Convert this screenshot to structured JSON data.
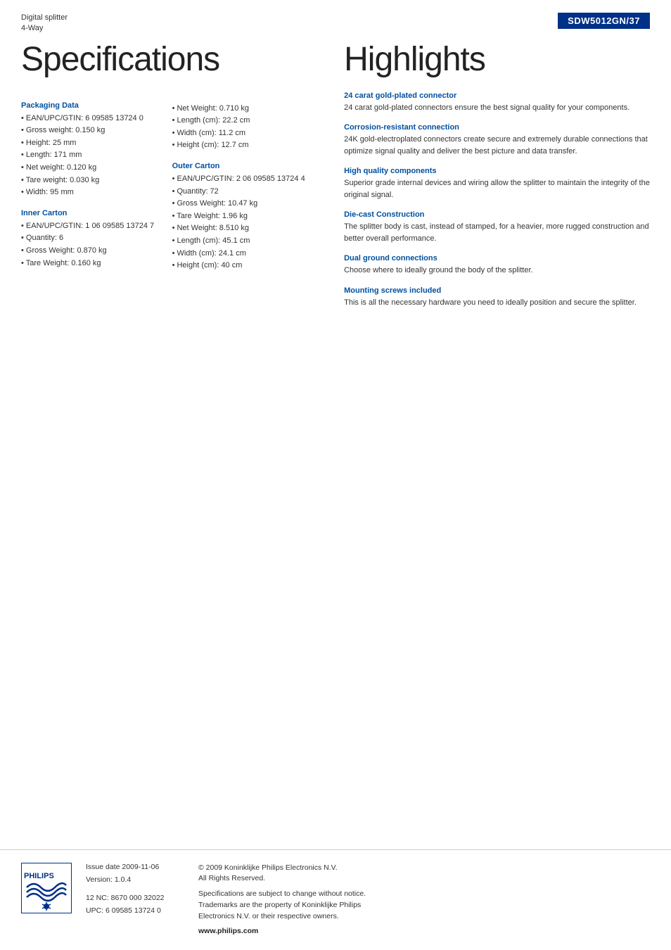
{
  "header": {
    "product_line": "Digital splitter",
    "product_variant": "4-Way",
    "model_number": "SDW5012GN/37"
  },
  "left_title": "Specifications",
  "right_title": "Highlights",
  "packaging_data": {
    "heading": "Packaging Data",
    "items": [
      "EAN/UPC/GTIN: 6 09585 13724 0",
      "Gross weight: 0.150 kg",
      "Height: 25 mm",
      "Length: 171 mm",
      "Net weight: 0.120 kg",
      "Tare weight: 0.030 kg",
      "Width: 95 mm"
    ]
  },
  "unit_data": {
    "items": [
      "Net Weight: 0.710 kg",
      "Length (cm): 22.2 cm",
      "Width (cm): 11.2 cm",
      "Height (cm): 12.7 cm"
    ]
  },
  "inner_carton": {
    "heading": "Inner Carton",
    "items": [
      "EAN/UPC/GTIN: 1 06 09585 13724 7",
      "Quantity: 6",
      "Gross Weight: 0.870 kg",
      "Tare Weight: 0.160 kg"
    ]
  },
  "outer_carton": {
    "heading": "Outer Carton",
    "items": [
      "EAN/UPC/GTIN: 2 06 09585 13724 4",
      "Quantity: 72",
      "Gross Weight: 10.47 kg",
      "Tare Weight: 1.96 kg",
      "Net Weight: 8.510 kg",
      "Length (cm): 45.1 cm",
      "Width (cm): 24.1 cm",
      "Height (cm): 40 cm"
    ]
  },
  "highlights": [
    {
      "heading": "24 carat gold-plated connector",
      "text": "24 carat gold-plated connectors ensure the best signal quality for your components."
    },
    {
      "heading": "Corrosion-resistant connection",
      "text": "24K gold-electroplated connectors create secure and extremely durable connections that optimize signal quality and deliver the best picture and data transfer."
    },
    {
      "heading": "High quality components",
      "text": "Superior grade internal devices and wiring allow the splitter to maintain the integrity of the original signal."
    },
    {
      "heading": "Die-cast Construction",
      "text": "The splitter body is cast, instead of stamped, for a heavier, more rugged construction and better overall performance."
    },
    {
      "heading": "Dual ground connections",
      "text": "Choose where to ideally ground the body of the splitter."
    },
    {
      "heading": "Mounting screws included",
      "text": "This is all the necessary hardware you need to ideally position and secure the splitter."
    }
  ],
  "footer": {
    "issue_label": "Issue date",
    "issue_date": "2009-11-06",
    "version_label": "Version:",
    "version": "1.0.4",
    "nc_label": "12 NC:",
    "nc_value": "8670 000 32022",
    "upc_label": "UPC:",
    "upc_value": "6 09585 13724 0",
    "copyright": "© 2009 Koninklijke Philips Electronics N.V.\nAll Rights Reserved.",
    "disclaimer": "Specifications are subject to change without notice.\nTrademarks are the property of Koninklijke Philips\nElectronics N.V. or their respective owners.",
    "website": "www.philips.com"
  }
}
